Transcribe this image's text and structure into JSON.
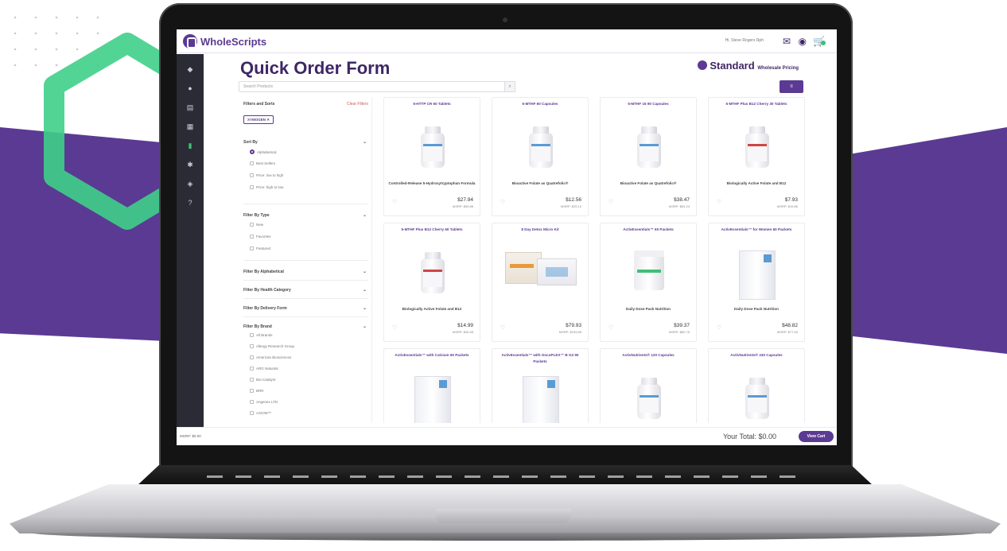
{
  "brand": {
    "name": "WholeScripts",
    "accent": "#5b3a93",
    "secondary": "#3fbf74"
  },
  "header": {
    "greeting": "Hi, Steve Rogers Rph",
    "icons": [
      "mail-icon",
      "user-account-icon",
      "cart-icon"
    ]
  },
  "sidebar": {
    "icons": [
      "dashboard-icon",
      "user-icon",
      "document-icon",
      "inbox-icon",
      "supplement-icon",
      "settings-icon",
      "tag-icon",
      "help-icon"
    ]
  },
  "page": {
    "title": "Quick Order Form",
    "tier": "Standard",
    "tier_suffix": "Wholesale Pricing",
    "search_placeholder": "Search Products"
  },
  "filters": {
    "heading": "Filters and Sorts",
    "clear": "Clear Filters",
    "active_chip": "XYMOGEN ✕",
    "sort_by": "Sort By",
    "sort_options": [
      "Alphabetical",
      "Best Sellers",
      "Price: low to high",
      "Price: high to low"
    ],
    "type_heading": "Filter By Type",
    "type_options": [
      "New",
      "Favorites",
      "Featured"
    ],
    "alpha_heading": "Filter By Alphabetical",
    "health_heading": "Filter By Health Category",
    "delivery_heading": "Filter By Delivery Form",
    "brand_heading": "Filter By Brand",
    "brand_options": [
      "All Brands",
      "Allergy Research Group",
      "American Biosciences",
      "ARG Naturals",
      "Bio-Catalyst",
      "BRR",
      "Angenex LTD",
      "AXIOM™"
    ]
  },
  "products": [
    {
      "title": "5-HTTP CR 60 Tablets",
      "name": "Controlled-Release 5-Hydroxytryptophan Formula",
      "price": "$27.94",
      "msrp": "MSRP: $55.88",
      "image": "bottle"
    },
    {
      "title": "5-MTHF 60 Capsules",
      "name": "Bioactive Folate as Quatrefolic®",
      "price": "$12.56",
      "msrp": "MSRP: $25.12",
      "image": "bottle"
    },
    {
      "title": "5-MTHF 15 90 Capsules",
      "name": "Bioactive Folate as Quatrefolic®",
      "price": "$38.47",
      "msrp": "MSRP: $64.24",
      "image": "bottle"
    },
    {
      "title": "5-MTHF Plus B12 Cherry 30 Tablets",
      "name": "Biologically Active Folate and B12",
      "price": "$7.93",
      "msrp": "MSRP: $15.86",
      "image": "bottle-red"
    },
    {
      "title": "5-MTHF Plus B12 Cherry 60 Tablets",
      "name": "Biologically Active Folate and B12",
      "price": "$14.99",
      "msrp": "MSRP: $28.98",
      "image": "bottle-red"
    },
    {
      "title": "8 Day Detox Micro Kit",
      "name": "",
      "price": "$79.93",
      "msrp": "MSRP: $159.85",
      "image": "kit"
    },
    {
      "title": "ActivEssentials™ 60 Packets",
      "name": "Daily Dose Pack Nutrition",
      "price": "$39.37",
      "msrp": "MSRP: $80.75",
      "image": "tub"
    },
    {
      "title": "ActivEssentials™ for Women 60 Packets",
      "name": "Daily Dose Pack Nutrition",
      "price": "$48.82",
      "msrp": "MSRP: $77.63",
      "image": "packbox"
    },
    {
      "title": "ActivEssentials™ with Calcium 60 Packets",
      "name": "",
      "price": "",
      "msrp": "",
      "image": "packbox"
    },
    {
      "title": "ActivEssentials™ with OncoPLEX™ B G3 90 Packets",
      "name": "",
      "price": "",
      "msrp": "",
      "image": "packbox"
    },
    {
      "title": "ActivNutrients® 120 Capsules",
      "name": "",
      "price": "",
      "msrp": "",
      "image": "bottle"
    },
    {
      "title": "ActivNutrients® 240 Capsules",
      "name": "",
      "price": "",
      "msrp": "",
      "image": "bottle"
    }
  ],
  "footer": {
    "msrp": "MSRP: $0.00",
    "total": "Your Total: $0.00",
    "view_cart": "View Cart"
  }
}
